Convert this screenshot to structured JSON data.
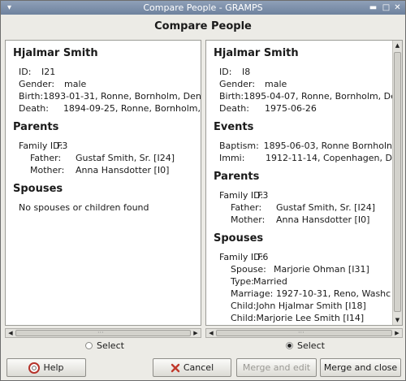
{
  "window": {
    "title": "Compare People - GRAMPS"
  },
  "heading": "Compare People",
  "left": {
    "name": "Hjalmar Smith",
    "id_label": "ID:",
    "id_value": "I21",
    "gender_label": "Gender:",
    "gender_value": "male",
    "birth_label": "Birth:",
    "birth_value": "1893-01-31, Ronne, Bornholm, Denm",
    "death_label": "Death:",
    "death_value": "1894-09-25, Ronne, Bornholm,",
    "parents_title": "Parents",
    "family_label": "Family ID:",
    "family_value": "F3",
    "father_label": "Father:",
    "father_value": "Gustaf Smith, Sr. [I24]",
    "mother_label": "Mother:",
    "mother_value": "Anna Hansdotter [I0]",
    "spouses_title": "Spouses",
    "spouses_empty": "No spouses or children found",
    "select_label": "Select",
    "selected": false
  },
  "right": {
    "name": "Hjalmar Smith",
    "id_label": "ID:",
    "id_value": "I8",
    "gender_label": "Gender:",
    "gender_value": "male",
    "birth_label": "Birth:",
    "birth_value": "1895-04-07, Ronne, Bornholm, De",
    "death_label": "Death:",
    "death_value": "1975-06-26",
    "events_title": "Events",
    "baptism_label": "Baptism:",
    "baptism_value": "1895-06-03, Ronne Bornholn",
    "immi_label": "Immi:",
    "immi_value": "1912-11-14, Copenhagen, D",
    "parents_title": "Parents",
    "family_label": "Family ID:",
    "family_value": "F3",
    "father_label": "Father:",
    "father_value": "Gustaf Smith, Sr. [I24]",
    "mother_label": "Mother:",
    "mother_value": "Anna Hansdotter [I0]",
    "spouses_title": "Spouses",
    "sp_family_label": "Family ID:",
    "sp_family_value": "F6",
    "spouse_label": "Spouse:",
    "spouse_value": "Marjorie Ohman [I31]",
    "type_label": "Type:",
    "type_value": "Married",
    "marriage_label": "Marriage:",
    "marriage_value": "1927-10-31, Reno, Washc",
    "child1_label": "Child:",
    "child1_value": "John Hjalmar Smith [I18]",
    "child2_label": "Child:",
    "child2_value": "Marjorie Lee Smith [I14]",
    "select_label": "Select",
    "selected": true
  },
  "buttons": {
    "help": "Help",
    "cancel": "Cancel",
    "merge_edit": "Merge and edit",
    "merge_close": "Merge and close"
  },
  "colors": {
    "titlebar": "#7b8ca6",
    "pane_bg": "#ffffff",
    "dialog_bg": "#ecebe6"
  }
}
